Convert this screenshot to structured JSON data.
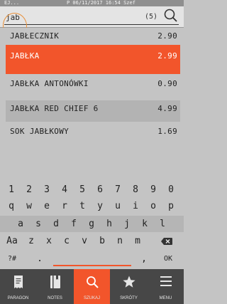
{
  "status": {
    "device": "EJ...",
    "info": "P 06/11/2017 16:54 Szef"
  },
  "search": {
    "value": "jab",
    "count": "(5)"
  },
  "results": [
    {
      "name": "JABŁECZNIK",
      "price": "2.90"
    },
    {
      "name": "JABŁKA",
      "price": "2.99"
    },
    {
      "name": "JABŁKA ANTONÓWKI",
      "price": "0.90"
    },
    {
      "name": "JABŁKA RED CHIEF 6",
      "price": "4.99"
    },
    {
      "name": "SOK JABŁKOWY",
      "price": "1.69"
    }
  ],
  "keyboard": {
    "row1": [
      "1",
      "2",
      "3",
      "4",
      "5",
      "6",
      "7",
      "8",
      "9",
      "0"
    ],
    "row2": [
      "q",
      "w",
      "e",
      "r",
      "t",
      "y",
      "u",
      "i",
      "o",
      "p"
    ],
    "row3": [
      "a",
      "s",
      "d",
      "f",
      "g",
      "h",
      "j",
      "k",
      "l"
    ],
    "row4": [
      "Aa",
      "z",
      "x",
      "c",
      "v",
      "b",
      "n",
      "m"
    ],
    "row5": {
      "symbols": "?#",
      "dot": ".",
      "comma": ",",
      "ok": "OK"
    }
  },
  "nav": [
    {
      "label": "PARAGON",
      "icon": "receipt-icon"
    },
    {
      "label": "NOTES",
      "icon": "notebook-icon"
    },
    {
      "label": "SZUKAJ",
      "icon": "search-icon"
    },
    {
      "label": "SKRÓTY",
      "icon": "star-icon"
    },
    {
      "label": "MENU",
      "icon": "menu-icon"
    }
  ],
  "colors": {
    "accent": "#f2552b",
    "navbar": "#474747",
    "background": "#c4c4c4"
  }
}
